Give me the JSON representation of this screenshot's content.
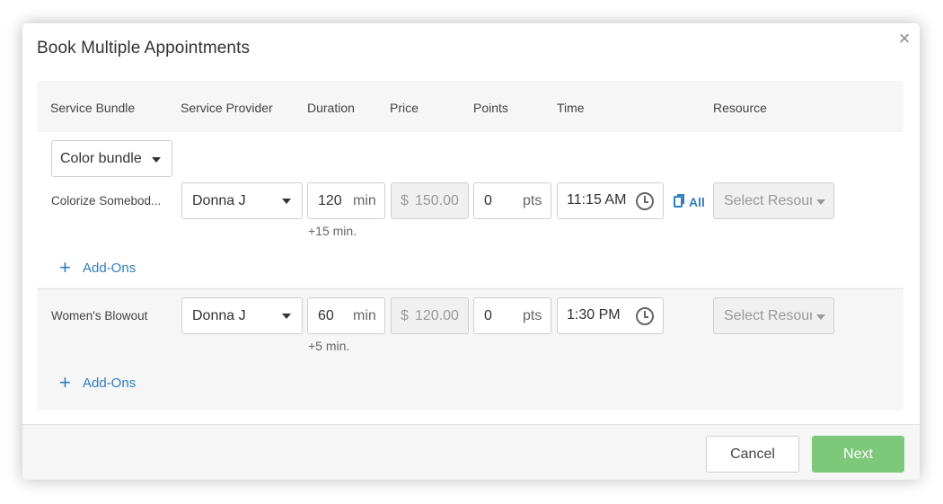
{
  "dialog": {
    "title": "Book Multiple Appointments",
    "close_glyph": "×"
  },
  "headers": {
    "service_bundle": "Service Bundle",
    "service_provider": "Service Provider",
    "duration": "Duration",
    "price": "Price",
    "points": "Points",
    "time": "Time",
    "resource": "Resource"
  },
  "bundle": {
    "selected": "Color bundle"
  },
  "rows": [
    {
      "service": "Colorize Somebod...",
      "provider": "Donna J",
      "duration": "120",
      "duration_unit": "min",
      "duration_extra": "+15 min.",
      "price_currency": "$",
      "price": "150.00",
      "points": "0",
      "points_unit": "pts",
      "time": "11:15 AM",
      "apply_all_label": "All",
      "resource_placeholder": "Select Resour",
      "addons_label": "Add-Ons"
    },
    {
      "service": "Women's Blowout",
      "provider": "Donna J",
      "duration": "60",
      "duration_unit": "min",
      "duration_extra": "+5 min.",
      "price_currency": "$",
      "price": "120.00",
      "points": "0",
      "points_unit": "pts",
      "time": "1:30 PM",
      "resource_placeholder": "Select Resour",
      "addons_label": "Add-Ons"
    }
  ],
  "footer": {
    "cancel_label": "Cancel",
    "next_label": "Next"
  },
  "colors": {
    "accent_link": "#2f7fc0",
    "next_button": "#7dc879"
  },
  "icons": [
    "close-icon",
    "chevron-down-icon",
    "clock-icon",
    "copy-icon",
    "plus-icon"
  ]
}
